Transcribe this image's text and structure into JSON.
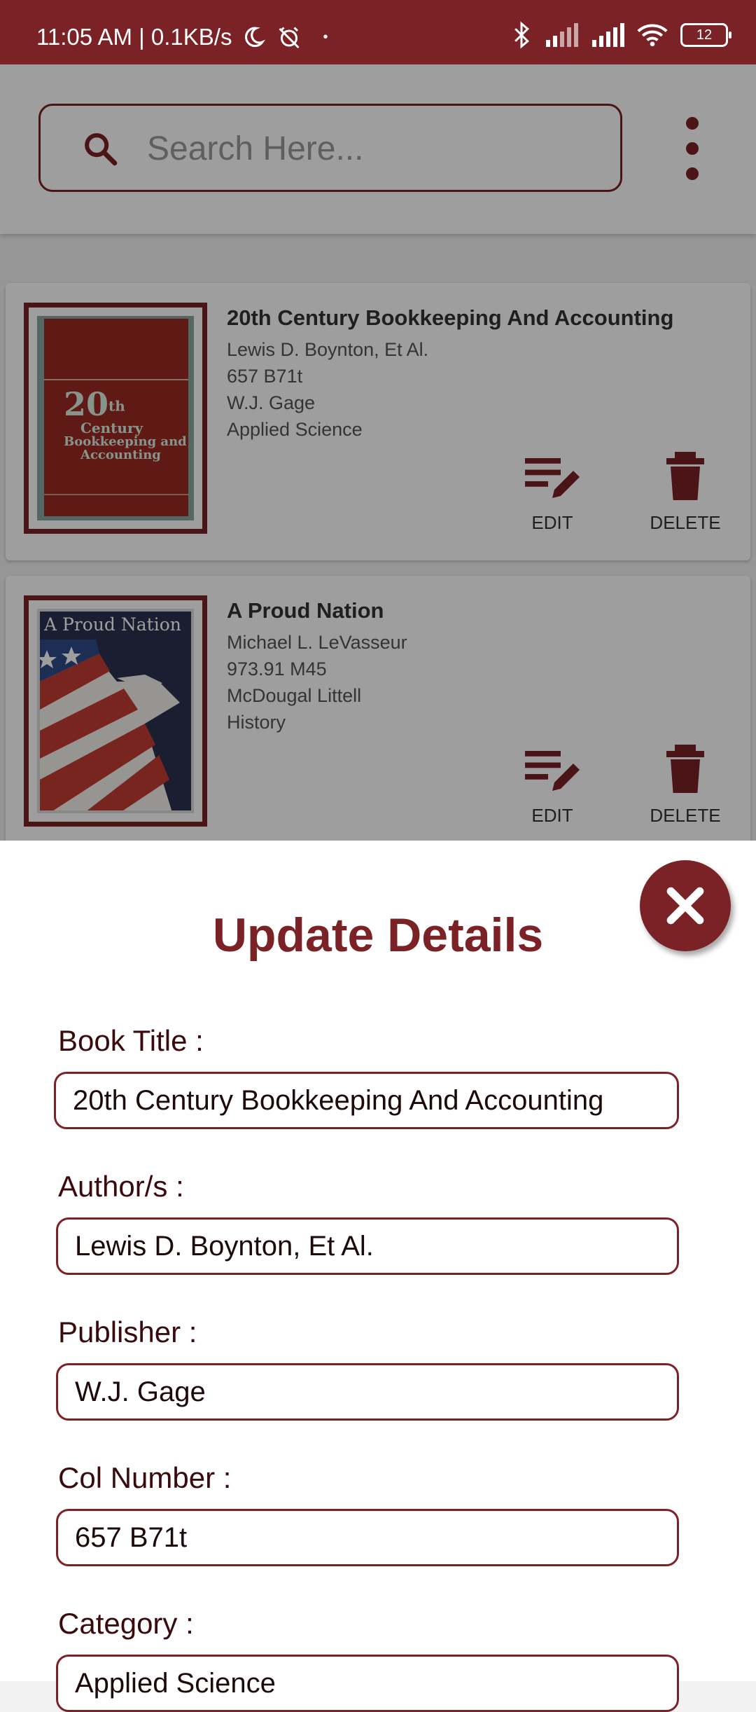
{
  "status_bar": {
    "time_speed": "11:05 AM | 0.1KB/s",
    "dot": "•",
    "battery": "12",
    "icons": [
      "moon-icon",
      "alarm-off-icon",
      "bluetooth-icon",
      "signal-icon",
      "signal-icon",
      "wifi-icon",
      "battery-icon"
    ]
  },
  "search": {
    "placeholder": "Search Here..."
  },
  "books": [
    {
      "title": "20th Century Bookkeeping And Accounting",
      "author": "Lewis D. Boynton, Et Al.",
      "call_number": "657 B71t",
      "publisher": "W.J. Gage",
      "category": "Applied Science",
      "edit_label": "EDIT",
      "delete_label": "DELETE",
      "cover_text": {
        "big": "20",
        "sup": "th",
        "line1": "Century",
        "line2": "Bookkeeping and",
        "line3": "Accounting"
      }
    },
    {
      "title": "A Proud Nation",
      "author": "Michael L. LeVasseur",
      "call_number": "973.91 M45",
      "publisher": "McDougal Littell",
      "category": "History",
      "edit_label": "EDIT",
      "delete_label": "DELETE",
      "cover_text": {
        "big": "A Proud Nation"
      }
    }
  ],
  "sheet": {
    "title": "Update Details",
    "fields": [
      {
        "label": "Book Title :",
        "value": "20th Century Bookkeeping And Accounting"
      },
      {
        "label": "Author/s :",
        "value": "Lewis D. Boynton, Et Al."
      },
      {
        "label": "Publisher :",
        "value": "W.J. Gage"
      },
      {
        "label": "Col Number :",
        "value": "657 B71t"
      },
      {
        "label": "Category :",
        "value": "Applied Science"
      }
    ]
  },
  "colors": {
    "primary": "#7a2226",
    "scrim": "rgba(0,0,0,0.38)"
  }
}
